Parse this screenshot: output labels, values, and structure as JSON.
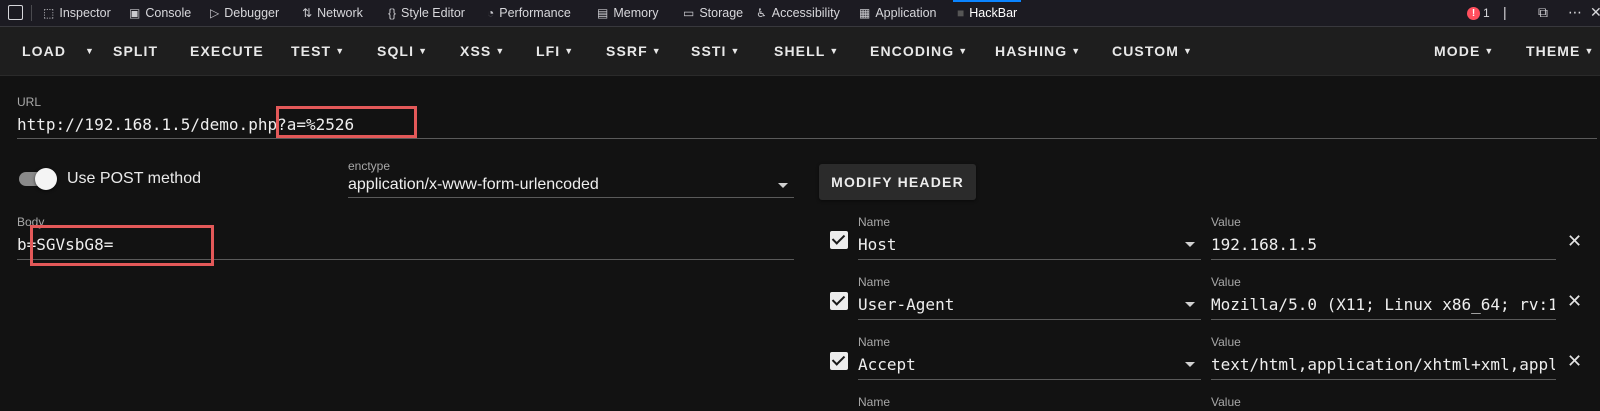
{
  "devtools": {
    "tabs": [
      {
        "label": "Inspector",
        "icon": "inspector-icon"
      },
      {
        "label": "Console",
        "icon": "console-icon"
      },
      {
        "label": "Debugger",
        "icon": "debugger-icon"
      },
      {
        "label": "Network",
        "icon": "network-icon"
      },
      {
        "label": "Style Editor",
        "icon": "style-editor-icon"
      },
      {
        "label": "Performance",
        "icon": "performance-icon"
      },
      {
        "label": "Memory",
        "icon": "memory-icon"
      },
      {
        "label": "Storage",
        "icon": "storage-icon"
      },
      {
        "label": "Accessibility",
        "icon": "accessibility-icon"
      },
      {
        "label": "Application",
        "icon": "application-icon"
      },
      {
        "label": "HackBar",
        "icon": "hackbar-icon"
      }
    ],
    "active_tab": "HackBar",
    "error_count": "1",
    "accent": "#0a84ff",
    "error_color": "#ff4f5e"
  },
  "toolbar": {
    "load": "LOAD",
    "split": "SPLIT",
    "execute": "EXECUTE",
    "test": "TEST",
    "sqli": "SQLI",
    "xss": "XSS",
    "lfi": "LFI",
    "ssrf": "SSRF",
    "ssti": "SSTI",
    "shell": "SHELL",
    "encoding": "ENCODING",
    "hashing": "HASHING",
    "custom": "CUSTOM",
    "mode": "MODE",
    "theme": "THEME"
  },
  "url": {
    "label": "URL",
    "value": "http://192.168.1.5/demo.php?a=%2526"
  },
  "post": {
    "toggle_label": "Use POST method",
    "enabled": true
  },
  "enctype": {
    "label": "enctype",
    "value": "application/x-www-form-urlencoded"
  },
  "body": {
    "label": "Body",
    "value": "b=SGVsbG8="
  },
  "modify_header_label": "MODIFY HEADER",
  "headers": {
    "name_label": "Name",
    "value_label": "Value",
    "rows": [
      {
        "name": "Host",
        "value": "192.168.1.5",
        "checked": true
      },
      {
        "name": "User-Agent",
        "value": "Mozilla/5.0 (X11; Linux x86_64; rv:1",
        "checked": true
      },
      {
        "name": "Accept",
        "value": "text/html,application/xhtml+xml,appl",
        "checked": true
      }
    ]
  },
  "highlight_color": "#e35959"
}
